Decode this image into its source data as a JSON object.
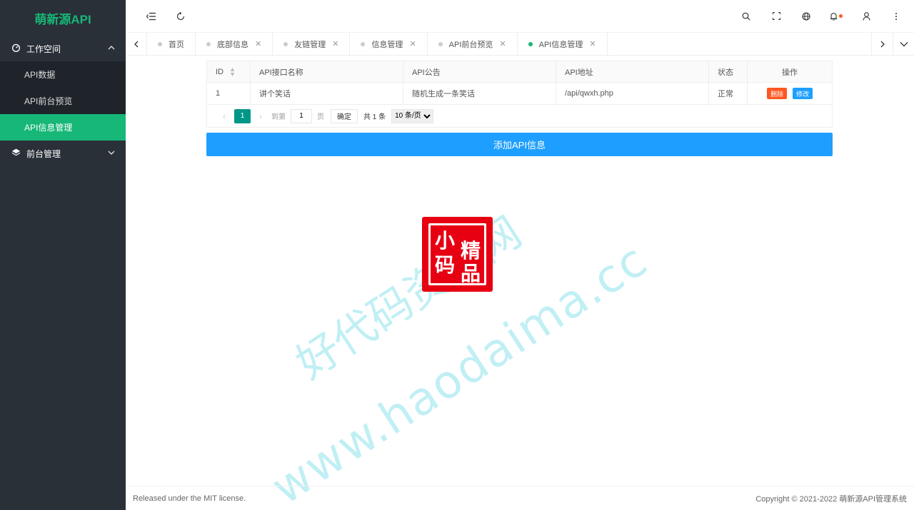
{
  "sidebar": {
    "logo": "萌新源API",
    "groups": [
      {
        "label": "工作空间",
        "icon": "gauge-icon",
        "expanded": true,
        "items": [
          {
            "label": "API数据"
          },
          {
            "label": "API前台预览"
          },
          {
            "label": "API信息管理",
            "active": true
          }
        ]
      },
      {
        "label": "前台管理",
        "icon": "layers-icon",
        "expanded": false
      }
    ]
  },
  "header": {
    "left_icons": [
      "menu-fold-icon",
      "refresh-icon"
    ],
    "right_icons": [
      "search-icon",
      "fullscreen-icon",
      "globe-icon",
      "bell-icon",
      "user-icon",
      "more-vertical-icon"
    ]
  },
  "tabs": [
    {
      "label": "首页",
      "closable": false
    },
    {
      "label": "底部信息",
      "closable": true
    },
    {
      "label": "友链管理",
      "closable": true
    },
    {
      "label": "信息管理",
      "closable": true
    },
    {
      "label": "API前台预览",
      "closable": true
    },
    {
      "label": "API信息管理",
      "closable": true,
      "active": true
    }
  ],
  "table": {
    "headers": [
      "ID",
      "API接口名称",
      "API公告",
      "API地址",
      "状态",
      "操作"
    ],
    "rows": [
      {
        "id": "1",
        "name": "讲个笑话",
        "notice": "随机生成一条笑话",
        "url": "/api/qwxh.php",
        "status": "正常"
      }
    ],
    "actions": {
      "delete": "删除",
      "edit": "修改"
    }
  },
  "pagination": {
    "current": "1",
    "goto_label": "到第",
    "goto_value": "1",
    "page_unit": "页",
    "confirm": "确定",
    "total": "共 1 条",
    "page_size": "10 条/页"
  },
  "add_button": "添加API信息",
  "watermark": {
    "line1": "好代码资源网",
    "line2": "www.haodaima.cc",
    "seal_chars": [
      "小",
      "精",
      "码",
      "品"
    ]
  },
  "footer": {
    "left": "Released under the MIT license.",
    "right": "Copyright © 2021-2022 萌新源API管理系统"
  },
  "colors": {
    "sidebar_bg": "#2a3038",
    "accent_green": "#16b777",
    "primary_blue": "#1e9fff",
    "danger": "#ff5722",
    "pager_teal": "#009688"
  }
}
